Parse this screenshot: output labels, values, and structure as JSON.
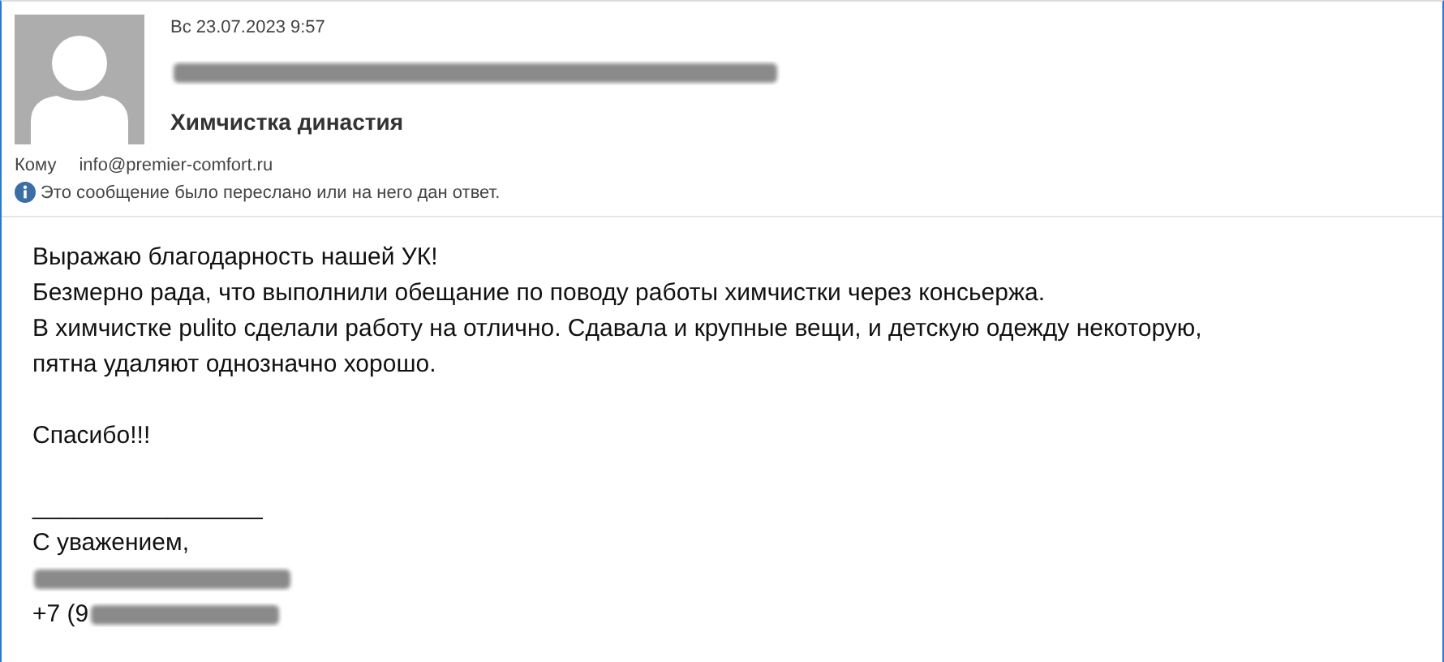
{
  "header": {
    "date": "Вс 23.07.2023 9:57",
    "sender": {
      "redacted": true
    },
    "subject": "Химчистка династия",
    "to_label": "Кому",
    "to": "info@premier-comfort.ru",
    "notice": "Это сообщение было переслано или на него дан ответ."
  },
  "body": {
    "paragraphs": [
      {
        "lines": [
          "Выражаю благодарность нашей УК!",
          "Безмерно рада, что выполнили обещание по поводу работы химчистки через консьержа.",
          "В химчистке pulito сделали работу на отлично. Сдавала и крупные вещи, и детскую одежду некоторую,",
          "пятна удаляют однозначно хорошо."
        ]
      },
      {
        "lines": [
          "Спасибо!!!"
        ]
      }
    ],
    "signature": [
      {
        "text": "_________________",
        "redacted": false
      },
      {
        "text": "С уважением,",
        "redacted": false
      },
      {
        "redacted": true
      },
      {
        "text": "+7 (9",
        "redacted": true
      }
    ]
  }
}
